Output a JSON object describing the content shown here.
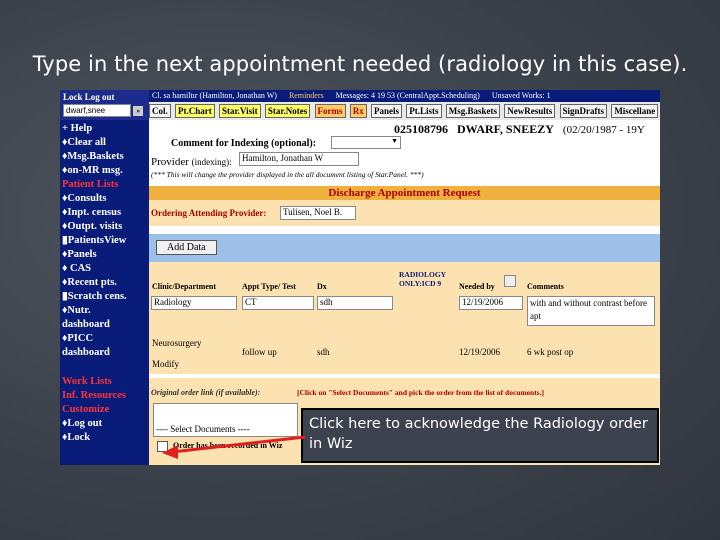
{
  "slide": {
    "title": "Type in the next appointment needed (radiology in this case)."
  },
  "sidebar": {
    "login": "Lock  Log out",
    "user_field": "dwarf,snee",
    "items": [
      "+ Help",
      "♦Clear all",
      "♦Msg.Baskets",
      "♦on-MR msg.",
      "Patient Lists",
      "♦Consults",
      "♦Inpt. census",
      "♦Outpt. visits",
      "▮PatientsView",
      "♦Panels",
      "♦  CAS",
      "♦Recent pts.",
      "▮Scratch cens.",
      "♦Nutr.",
      "dashboard",
      "♦PICC",
      "dashboard"
    ],
    "bottom_items": [
      "Work Lists",
      "Inf. Resources",
      "Customize",
      "♦Log out",
      "♦Lock"
    ]
  },
  "topbar": {
    "user": "Cl. sа hamiltır (Hamilton, Jonathan W)",
    "reminders": "Reminders",
    "messages": "Messages: 4 19 53 (CentralAppt.Scheduling)",
    "unsaved": "Unsaved Works: 1"
  },
  "tabs": [
    "Col.",
    "Pt.Chart",
    "Star.Visit",
    "Star.Notes",
    "Forms",
    "Rx",
    "Panels",
    "Pt.Lists",
    "Msg.Baskets",
    "NewResults",
    "SignDrafts",
    "Miscellane"
  ],
  "patient": {
    "mrn": "025108796",
    "name": "DWARF, SNEEZY",
    "dob": "(02/20/1987 - 19Y"
  },
  "form": {
    "comment_label": "Comment for Indexing (optional):",
    "provider_label": "Provider",
    "provider_indexing": "(indexing):",
    "provider_value": "Hamilton, Jonathan W",
    "note": "(*** This will change the provider displayed in the all document listing of Star.Panel. ***)",
    "discharge_header": "Discharge Appointment Request",
    "ordering_label": "Ordering Attending Provider:",
    "ordering_value": "Tulisen, Noel B.",
    "add_data": "Add Data",
    "col_clinic": "Clinic/Department",
    "col_appt": "Appt Type/ Test",
    "col_dx": "Dx",
    "col_radiology": "RADIOLOGY ONLY:ICD 9",
    "col_needed": "Needed by",
    "col_comments": "Comments",
    "row1": {
      "clinic": "Radiology",
      "appt": "CT",
      "dx": "sdh",
      "needed": "12/19/2006",
      "comments": "with and without contrast before apt"
    },
    "row2": {
      "clinic": "Neurosurgery",
      "modify": "Modify",
      "appt": "follow up",
      "dx": "sdh",
      "needed": "12/19/2006",
      "comments": "6  wk  post  op"
    },
    "original_label": "Original order link (if available):",
    "original_note": "[Click on \"Select Documents\" and pick the order from the list of documents.]",
    "select_docs": "---- Select Documents ----",
    "order_recorded": "Order has been recorded in Wiz"
  },
  "callout": {
    "text": "Click here to acknowledge the Radiology order in Wiz"
  },
  "colors": {
    "sidebar": "#0a1c7a",
    "discharge": "#f0b040",
    "arrow": "#e02020"
  }
}
